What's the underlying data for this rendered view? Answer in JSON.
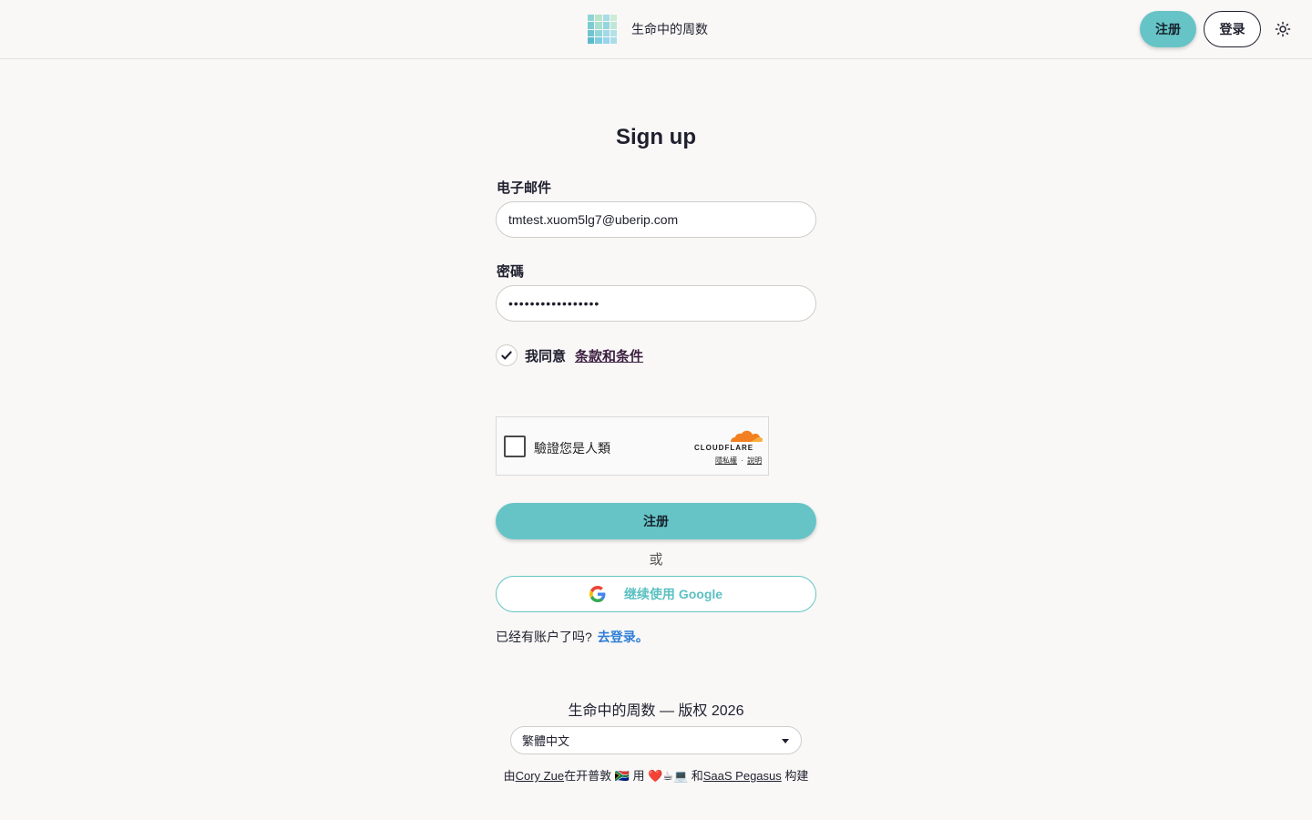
{
  "header": {
    "brand_name": "生命中的周数",
    "signup_label": "注册",
    "login_label": "登录",
    "theme_icon": "sun-icon"
  },
  "form": {
    "title": "Sign up",
    "email_label": "电子邮件",
    "email_value": "tmtest.xuom5lg7@uberip.com",
    "password_label": "密碼",
    "password_value": "•••••••••••••••••",
    "agree_text": "我同意",
    "terms_link": "条款和条件",
    "submit_label": "注册",
    "or_text": "或",
    "google_label": "继续使用 Google",
    "have_account_text": "已经有账户了吗?",
    "login_link": "去登录。"
  },
  "turnstile": {
    "label": "驗證您是人類",
    "brand": "CLOUDFLARE",
    "privacy": "隱私權",
    "separator": "·",
    "help": "說明"
  },
  "footer": {
    "copyright": "生命中的周数 — 版权 2026",
    "language": "繁體中文",
    "built_prefix": "由",
    "author": "Cory Zue",
    "built_middle": "在开普敦 🇿🇦 用 ❤️☕💻 和",
    "pegasus": "SaaS Pegasus",
    "built_suffix": " 构建"
  },
  "colors": {
    "accent": "#66c4c6",
    "link_blue": "#2f7fd6",
    "background": "#f9f8f7"
  }
}
